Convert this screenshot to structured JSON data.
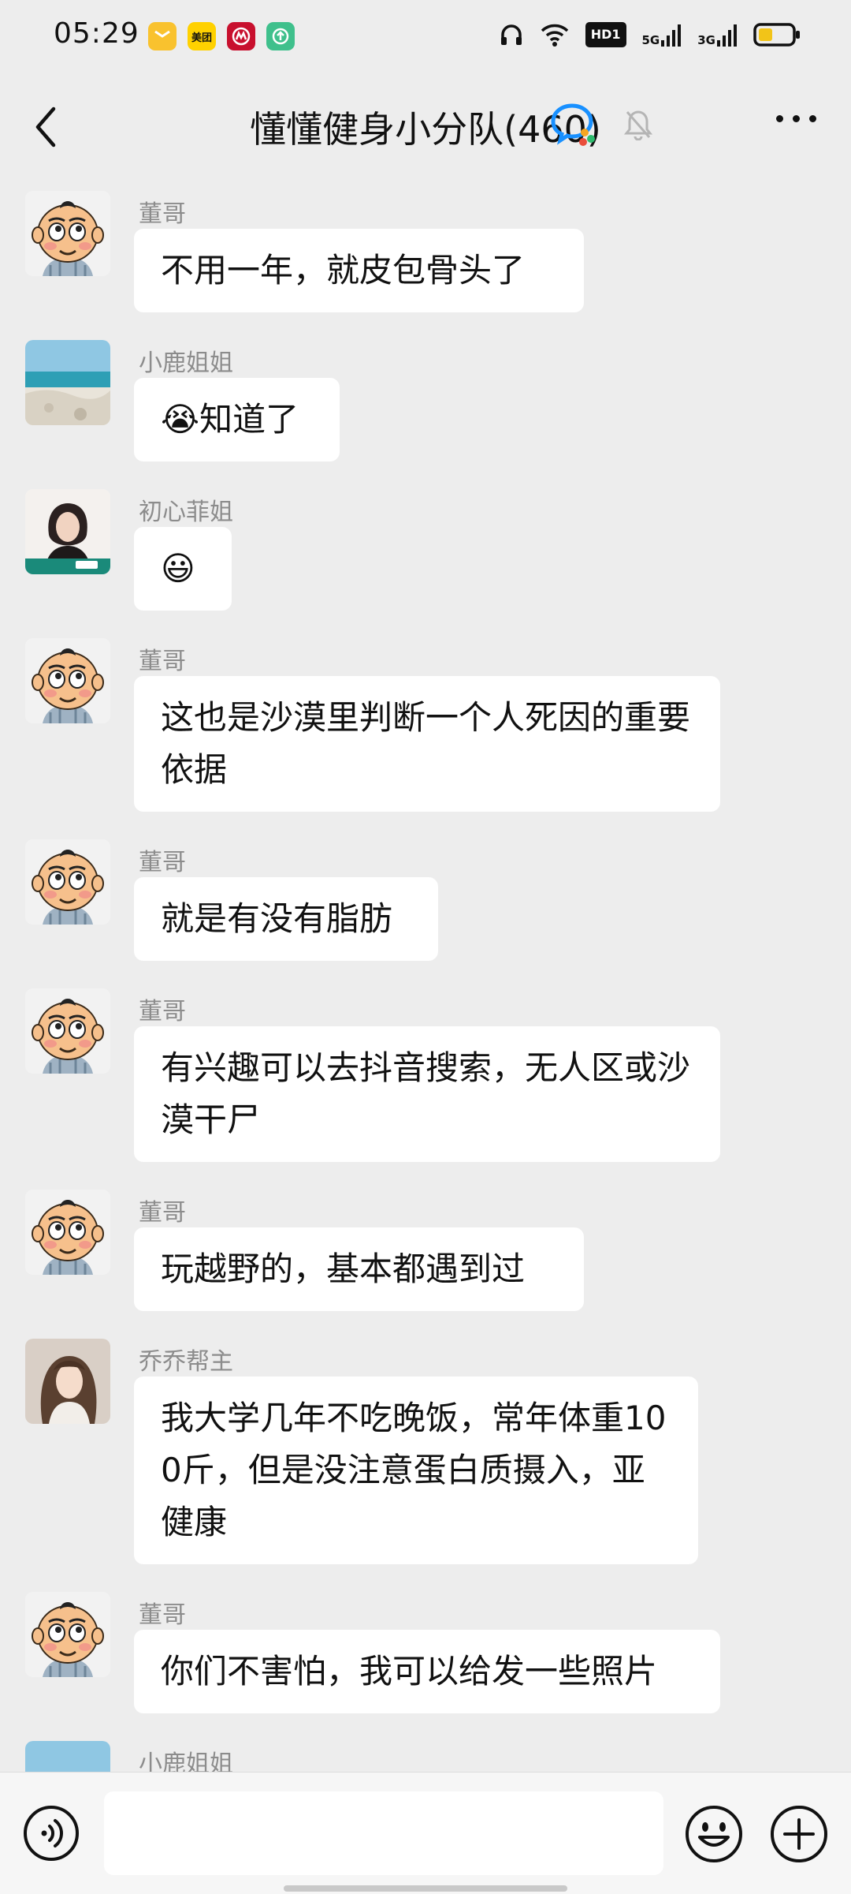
{
  "status_bar": {
    "time": "05:29",
    "app_badges": [
      {
        "icon": "wallet-icon",
        "color": "#f9c22e",
        "text": ""
      },
      {
        "icon": "meituan-icon",
        "color": "#ffd100",
        "text": "美团"
      },
      {
        "icon": "cmb-bank-icon",
        "color": "#c8102e",
        "text": ""
      },
      {
        "icon": "green-app-icon",
        "color": "#3fc08c",
        "text": ""
      }
    ],
    "hd_label": "HD1",
    "net_5g": "5G",
    "net_3g": "3G"
  },
  "header": {
    "title": "懂懂健身小分队(460)"
  },
  "messages": [
    {
      "sender": "董哥",
      "text": "不用一年，就皮包骨头了",
      "avatar": "cartoon-baby"
    },
    {
      "sender": "小鹿姐姐",
      "text": "😭知道了",
      "avatar": "beach"
    },
    {
      "sender": "初心菲姐",
      "text": "😃",
      "avatar": "woman-portrait"
    },
    {
      "sender": "董哥",
      "text": "这也是沙漠里判断一个人死因的重要依据",
      "avatar": "cartoon-baby"
    },
    {
      "sender": "董哥",
      "text": "就是有没有脂肪",
      "avatar": "cartoon-baby"
    },
    {
      "sender": "董哥",
      "text": "有兴趣可以去抖音搜索，无人区或沙漠干尸",
      "avatar": "cartoon-baby"
    },
    {
      "sender": "董哥",
      "text": "玩越野的，基本都遇到过",
      "avatar": "cartoon-baby"
    },
    {
      "sender": "乔乔帮主",
      "text": "我大学几年不吃晚饭，常年体重100斤，但是没注意蛋白质摄入，亚健康",
      "avatar": "girl-photo"
    },
    {
      "sender": "董哥",
      "text": "你们不害怕，我可以给发一些照片",
      "avatar": "cartoon-baby"
    },
    {
      "sender": "小鹿姐姐",
      "text": "",
      "avatar": "beach"
    }
  ],
  "input_bar": {
    "placeholder": "",
    "voice_icon": "voice-icon",
    "emoji_icon": "emoji-icon",
    "plus_icon": "plus-icon"
  },
  "colors": {
    "chat_bg": "#ededed",
    "bubble_bg": "#ffffff",
    "sender_text": "#8c8c8c"
  }
}
